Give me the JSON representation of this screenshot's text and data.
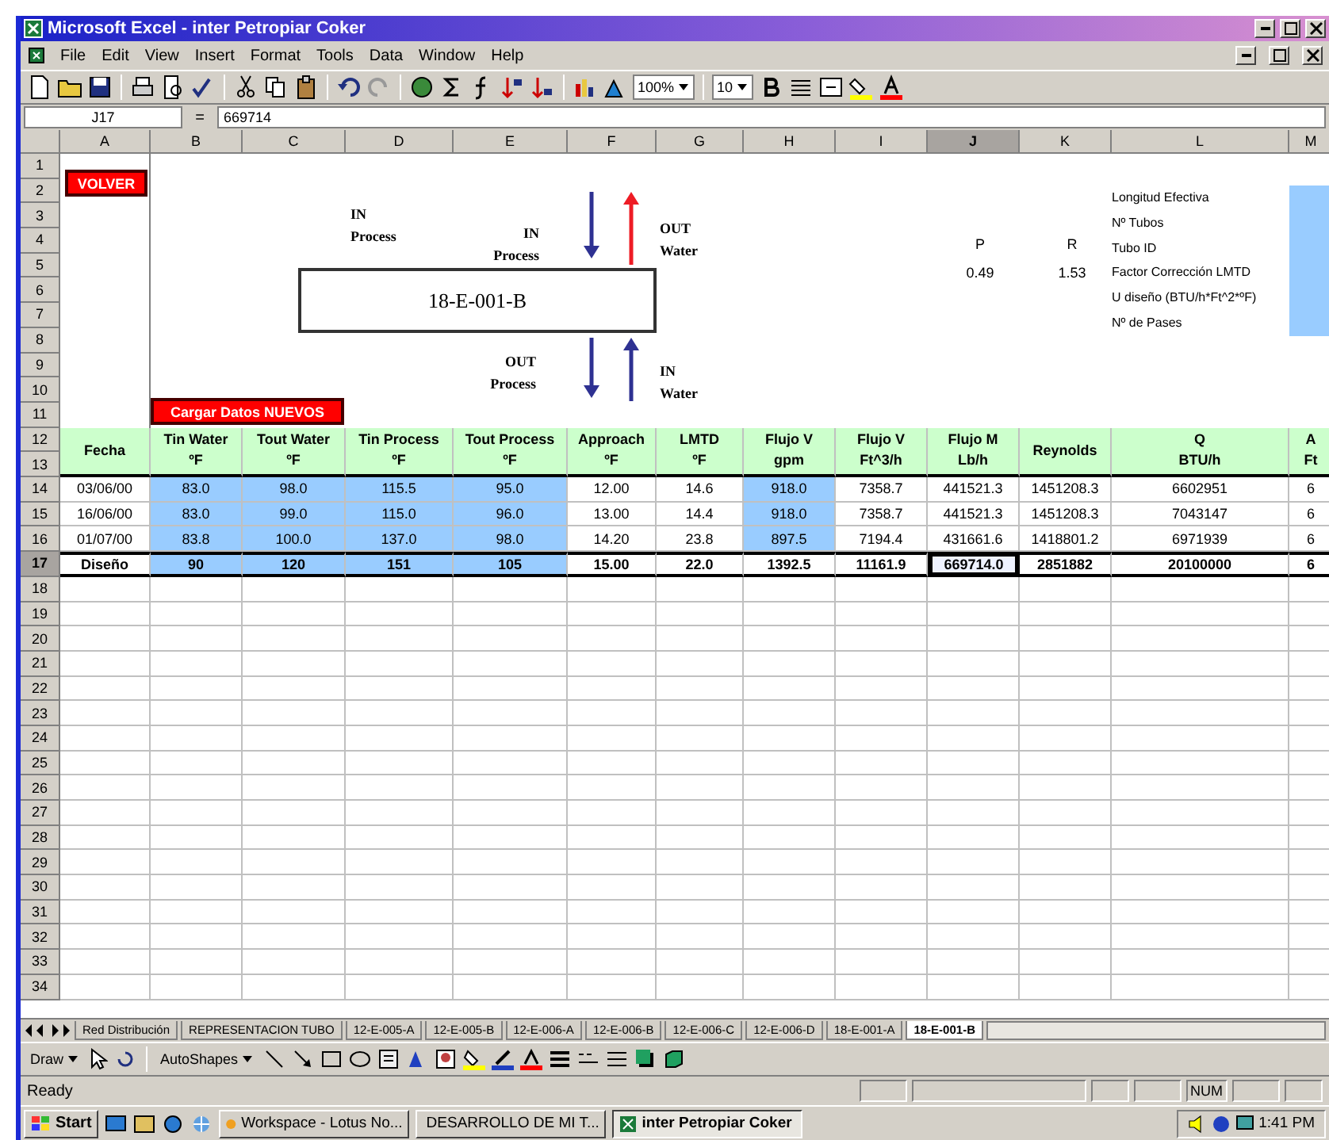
{
  "window": {
    "title": "Microsoft Excel - inter Petropiar Coker"
  },
  "menu": [
    "File",
    "Edit",
    "View",
    "Insert",
    "Format",
    "Tools",
    "Data",
    "Window",
    "Help"
  ],
  "toolbar": {
    "zoom": "100%",
    "font_size": "10"
  },
  "formula_bar": {
    "name_box": "J17",
    "equals": "=",
    "value": "669714"
  },
  "columns": [
    {
      "label": "A",
      "selected": false
    },
    {
      "label": "B",
      "selected": false
    },
    {
      "label": "C",
      "selected": false
    },
    {
      "label": "D",
      "selected": false
    },
    {
      "label": "E",
      "selected": false
    },
    {
      "label": "F",
      "selected": false
    },
    {
      "label": "G",
      "selected": false
    },
    {
      "label": "H",
      "selected": false
    },
    {
      "label": "I",
      "selected": false
    },
    {
      "label": "J",
      "selected": true
    },
    {
      "label": "K",
      "selected": false
    },
    {
      "label": "L",
      "selected": false
    },
    {
      "label": "M",
      "selected": false
    }
  ],
  "row_headers": [
    {
      "label": "1",
      "selected": false
    },
    {
      "label": "2",
      "selected": false
    },
    {
      "label": "3",
      "selected": false
    },
    {
      "label": "4",
      "selected": false
    },
    {
      "label": "5",
      "selected": false
    },
    {
      "label": "6",
      "selected": false
    },
    {
      "label": "7",
      "selected": false
    },
    {
      "label": "8",
      "selected": false
    },
    {
      "label": "9",
      "selected": false
    },
    {
      "label": "10",
      "selected": false
    },
    {
      "label": "11",
      "selected": false
    },
    {
      "label": "12",
      "selected": false
    },
    {
      "label": "13",
      "selected": false
    },
    {
      "label": "14",
      "selected": false
    },
    {
      "label": "15",
      "selected": false
    },
    {
      "label": "16",
      "selected": false
    },
    {
      "label": "17",
      "selected": true
    },
    {
      "label": "18",
      "selected": false
    },
    {
      "label": "19",
      "selected": false
    },
    {
      "label": "20",
      "selected": false
    },
    {
      "label": "21",
      "selected": false
    },
    {
      "label": "22",
      "selected": false
    },
    {
      "label": "23",
      "selected": false
    },
    {
      "label": "24",
      "selected": false
    },
    {
      "label": "25",
      "selected": false
    },
    {
      "label": "26",
      "selected": false
    },
    {
      "label": "27",
      "selected": false
    },
    {
      "label": "28",
      "selected": false
    },
    {
      "label": "29",
      "selected": false
    },
    {
      "label": "30",
      "selected": false
    },
    {
      "label": "31",
      "selected": false
    },
    {
      "label": "32",
      "selected": false
    },
    {
      "label": "33",
      "selected": false
    },
    {
      "label": "34",
      "selected": false
    }
  ],
  "sheet_top": {
    "buttons": [
      "VOLVER",
      "Cargar Datos NUEVOS"
    ],
    "diagram": {
      "equipment": "18-E-001-B",
      "labels": [
        "IN\nProcess",
        "IN\nProcess",
        "OUT\nWater",
        "OUT\nProcess",
        "IN\nWater"
      ],
      "arrows": [
        {
          "kind": "down",
          "color": "#2e3192"
        },
        {
          "kind": "up",
          "color": "#ee1c25"
        },
        {
          "kind": "down",
          "color": "#2e3192"
        },
        {
          "kind": "up",
          "color": "#2e3192"
        }
      ]
    },
    "params": [
      {
        "name": "P",
        "value": "0.49"
      },
      {
        "name": "R",
        "value": "1.53"
      }
    ],
    "properties": [
      "Longitud Efectiva",
      "Nº Tubos",
      "Tubo ID",
      "Factor Corrección LMTD",
      "U diseño (BTU/h*Ft^2*ºF)",
      "Nº de Pases"
    ]
  },
  "table": {
    "header": [
      {
        "top": "Fecha"
      },
      {
        "top": "Tin Water",
        "bottom": "ºF"
      },
      {
        "top": "Tout Water",
        "bottom": "ºF"
      },
      {
        "top": "Tin Process",
        "bottom": "ºF"
      },
      {
        "top": "Tout Process",
        "bottom": "ºF"
      },
      {
        "top": "Approach",
        "bottom": "ºF"
      },
      {
        "top": "LMTD",
        "bottom": "ºF"
      },
      {
        "top": "Flujo V",
        "bottom": "gpm"
      },
      {
        "top": "Flujo V",
        "bottom": "Ft^3/h"
      },
      {
        "top": "Flujo M",
        "bottom": "Lb/h"
      },
      {
        "top": "Reynolds"
      },
      {
        "top": "Q",
        "bottom": "BTU/h"
      },
      {
        "top": "A",
        "bottom": "Ft"
      }
    ],
    "rows": [
      {
        "kind": "data",
        "cells": [
          {
            "text": "03/06/00",
            "input": false,
            "selected": false
          },
          {
            "text": "83.0",
            "input": true,
            "selected": false
          },
          {
            "text": "98.0",
            "input": true,
            "selected": false
          },
          {
            "text": "115.5",
            "input": true,
            "selected": false
          },
          {
            "text": "95.0",
            "input": true,
            "selected": false
          },
          {
            "text": "12.00",
            "input": false,
            "selected": false
          },
          {
            "text": "14.6",
            "input": false,
            "selected": false
          },
          {
            "text": "918.0",
            "input": true,
            "selected": false
          },
          {
            "text": "7358.7",
            "input": false,
            "selected": false
          },
          {
            "text": "441521.3",
            "input": false,
            "selected": false
          },
          {
            "text": "1451208.3",
            "input": false,
            "selected": false
          },
          {
            "text": "6602951",
            "input": false,
            "selected": false
          },
          {
            "text": "6",
            "input": false,
            "selected": false
          }
        ]
      },
      {
        "kind": "data",
        "cells": [
          {
            "text": "16/06/00",
            "input": false,
            "selected": false
          },
          {
            "text": "83.0",
            "input": true,
            "selected": false
          },
          {
            "text": "99.0",
            "input": true,
            "selected": false
          },
          {
            "text": "115.0",
            "input": true,
            "selected": false
          },
          {
            "text": "96.0",
            "input": true,
            "selected": false
          },
          {
            "text": "13.00",
            "input": false,
            "selected": false
          },
          {
            "text": "14.4",
            "input": false,
            "selected": false
          },
          {
            "text": "918.0",
            "input": true,
            "selected": false
          },
          {
            "text": "7358.7",
            "input": false,
            "selected": false
          },
          {
            "text": "441521.3",
            "input": false,
            "selected": false
          },
          {
            "text": "1451208.3",
            "input": false,
            "selected": false
          },
          {
            "text": "7043147",
            "input": false,
            "selected": false
          },
          {
            "text": "6",
            "input": false,
            "selected": false
          }
        ]
      },
      {
        "kind": "data",
        "cells": [
          {
            "text": "01/07/00",
            "input": false,
            "selected": false
          },
          {
            "text": "83.8",
            "input": true,
            "selected": false
          },
          {
            "text": "100.0",
            "input": true,
            "selected": false
          },
          {
            "text": "137.0",
            "input": true,
            "selected": false
          },
          {
            "text": "98.0",
            "input": true,
            "selected": false
          },
          {
            "text": "14.20",
            "input": false,
            "selected": false
          },
          {
            "text": "23.8",
            "input": false,
            "selected": false
          },
          {
            "text": "897.5",
            "input": true,
            "selected": false
          },
          {
            "text": "7194.4",
            "input": false,
            "selected": false
          },
          {
            "text": "431661.6",
            "input": false,
            "selected": false
          },
          {
            "text": "1418801.2",
            "input": false,
            "selected": false
          },
          {
            "text": "6971939",
            "input": false,
            "selected": false
          },
          {
            "text": "6",
            "input": false,
            "selected": false
          }
        ]
      },
      {
        "kind": "design",
        "cells": [
          {
            "text": "Diseño",
            "input": false,
            "selected": false
          },
          {
            "text": "90",
            "input": true,
            "selected": false
          },
          {
            "text": "120",
            "input": true,
            "selected": false
          },
          {
            "text": "151",
            "input": true,
            "selected": false
          },
          {
            "text": "105",
            "input": true,
            "selected": false
          },
          {
            "text": "15.00",
            "input": false,
            "selected": false
          },
          {
            "text": "22.0",
            "input": false,
            "selected": false
          },
          {
            "text": "1392.5",
            "input": false,
            "selected": false
          },
          {
            "text": "11161.9",
            "input": false,
            "selected": false
          },
          {
            "text": "669714.0",
            "input": false,
            "selected": true
          },
          {
            "text": "2851882",
            "input": false,
            "selected": false
          },
          {
            "text": "20100000",
            "input": false,
            "selected": false
          },
          {
            "text": "6",
            "input": false,
            "selected": false
          }
        ]
      }
    ]
  },
  "sheet_tabs": [
    {
      "label": "Red Distribución",
      "selected": false
    },
    {
      "label": "REPRESENTACION TUBO",
      "selected": false
    },
    {
      "label": "12-E-005-A",
      "selected": false
    },
    {
      "label": "12-E-005-B",
      "selected": false
    },
    {
      "label": "12-E-006-A",
      "selected": false
    },
    {
      "label": "12-E-006-B",
      "selected": false
    },
    {
      "label": "12-E-006-C",
      "selected": false
    },
    {
      "label": "12-E-006-D",
      "selected": false
    },
    {
      "label": "18-E-001-A",
      "selected": false
    },
    {
      "label": "18-E-001-B",
      "selected": true
    }
  ],
  "drawing_toolbar": {
    "draw": "Draw",
    "autoshapes": "AutoShapes"
  },
  "status_bar": {
    "text": "Ready",
    "num": "NUM"
  },
  "taskbar": {
    "start": "Start",
    "tasks": [
      {
        "label": "Workspace - Lotus No...",
        "selected": false
      },
      {
        "label": "DESARROLLO DE MI T...",
        "selected": false
      },
      {
        "label": "inter Petropiar Coker",
        "selected": true
      }
    ],
    "clock": "1:41 PM"
  }
}
